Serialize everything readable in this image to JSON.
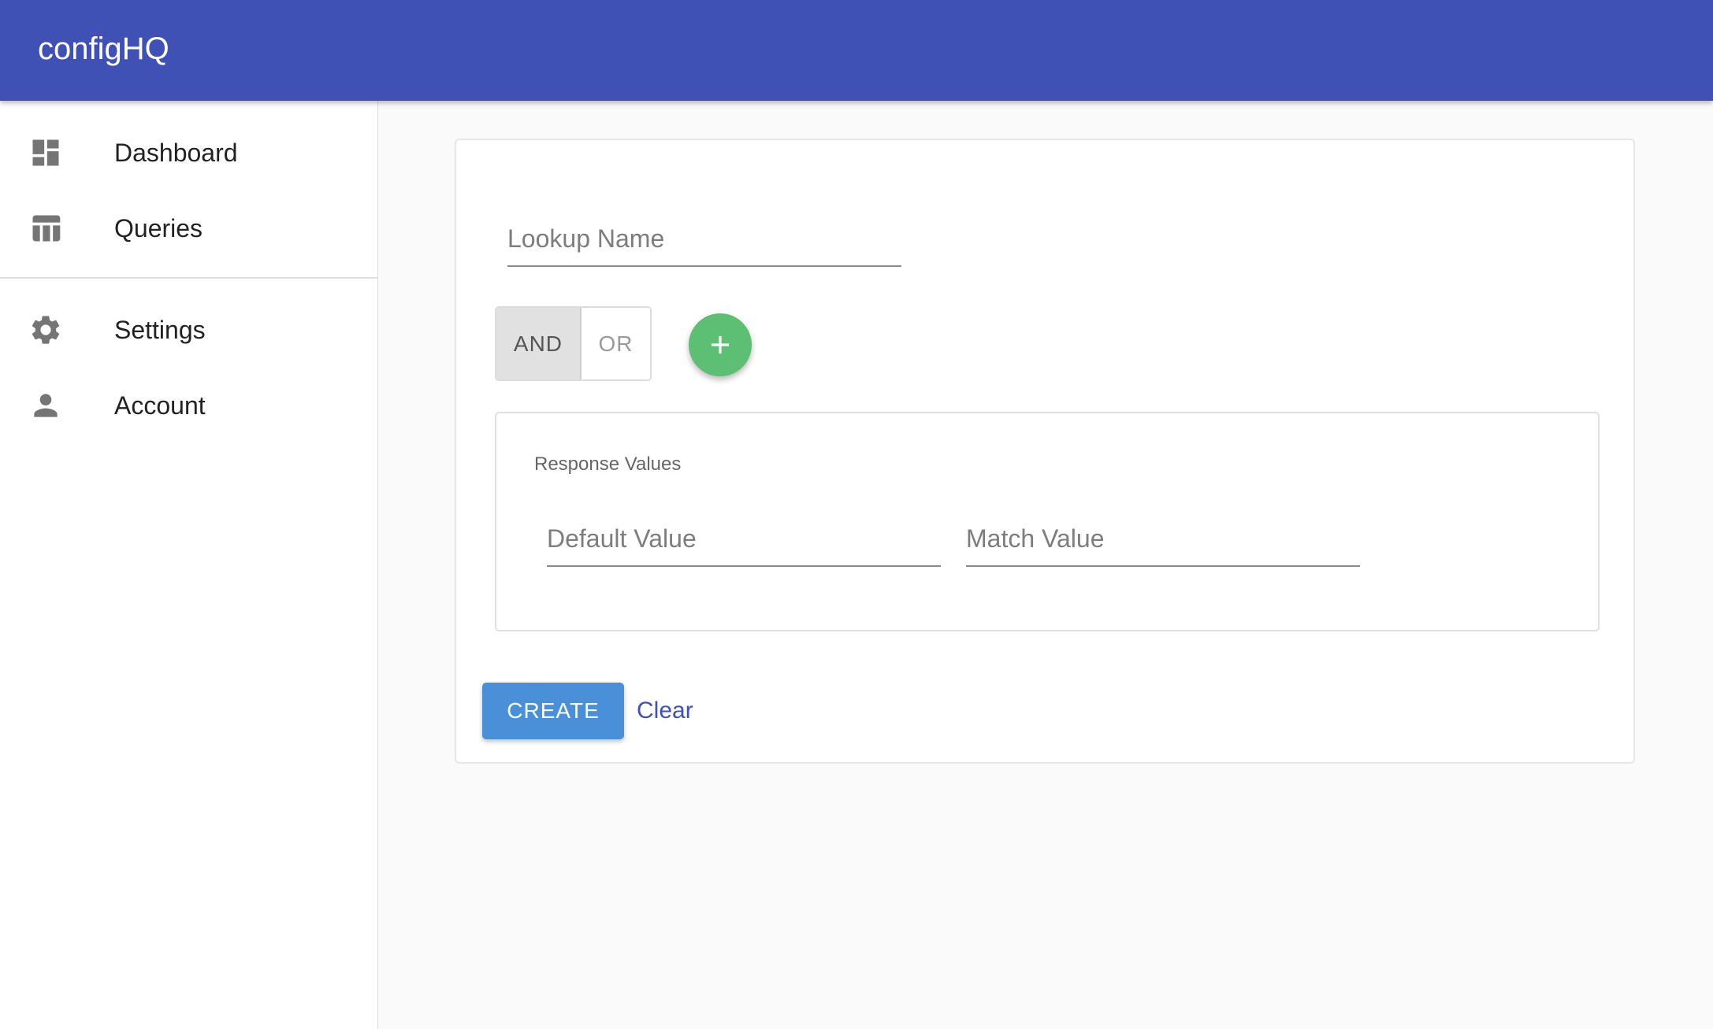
{
  "app": {
    "title": "configHQ"
  },
  "sidebar": {
    "items": [
      {
        "label": "Dashboard",
        "icon": "dashboard-icon"
      },
      {
        "label": "Queries",
        "icon": "table-icon"
      },
      {
        "label": "Settings",
        "icon": "gear-icon"
      },
      {
        "label": "Account",
        "icon": "person-icon"
      }
    ]
  },
  "form": {
    "lookup_name": {
      "placeholder": "Lookup Name",
      "value": ""
    },
    "operator_toggle": {
      "options": [
        "AND",
        "OR"
      ],
      "selected": "AND"
    },
    "add_condition_icon": "plus-icon",
    "response_values": {
      "title": "Response Values",
      "default_value": {
        "placeholder": "Default Value",
        "value": ""
      },
      "match_value": {
        "placeholder": "Match Value",
        "value": ""
      }
    },
    "create_label": "CREATE",
    "clear_label": "Clear"
  },
  "colors": {
    "appbar": "#3f51b5",
    "fab": "#5cbf74",
    "create_button": "#4a90d9",
    "link": "#3f51b5",
    "icon": "#757575"
  }
}
